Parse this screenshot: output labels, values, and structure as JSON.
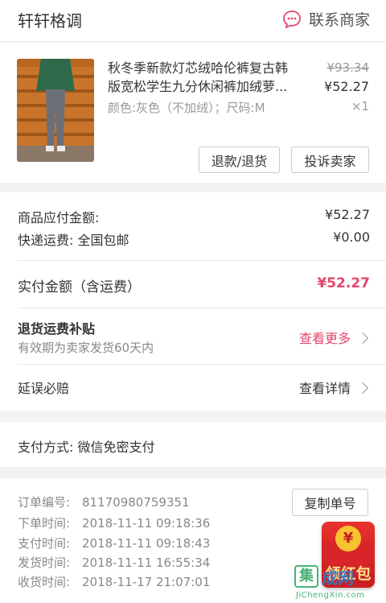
{
  "shop": {
    "name": "轩轩格调",
    "contact_label": "联系商家"
  },
  "product": {
    "title": "秋冬季新款灯芯绒哈伦裤复古韩版宽松学生九分休闲裤加绒萝...",
    "spec": "颜色:灰色（不加绒）；尺码:M",
    "original_price": "¥93.34",
    "price": "¥52.27",
    "quantity": "×1",
    "refund_label": "退款/退货",
    "complain_label": "投诉卖家"
  },
  "amounts": {
    "goods_label": "商品应付金额:",
    "goods_value": "¥52.27",
    "shipping_label": "快递运费: 全国包邮",
    "shipping_value": "¥0.00",
    "total_label": "实付金额（含运费）",
    "total_value": "¥52.27",
    "return_subsidy_title": "退货运费补贴",
    "return_subsidy_sub": "有效期为卖家发货60天内",
    "return_subsidy_link": "查看更多",
    "delay_title": "延误必赔",
    "delay_link": "查看详情"
  },
  "payment": {
    "method": "支付方式: 微信免密支付"
  },
  "order": {
    "copy_label": "复制单号",
    "rows": [
      {
        "key": "订单编号:",
        "value": "81170980759351"
      },
      {
        "key": "下单时间:",
        "value": "2018-11-11  09:18:36"
      },
      {
        "key": "支付时间:",
        "value": "2018-11-11  09:18:43"
      },
      {
        "key": "发货时间:",
        "value": "2018-11-11  16:55:34"
      },
      {
        "key": "收货时间:",
        "value": "2018-11-17  21:07:01"
      }
    ]
  },
  "redpacket": {
    "coin_symbol": "¥",
    "label": "领红包"
  },
  "watermark": {
    "box_char": "集",
    "text": "成网",
    "url": "JiChengXin.com"
  },
  "colors": {
    "accent": "#e5466b",
    "muted": "#888888"
  }
}
